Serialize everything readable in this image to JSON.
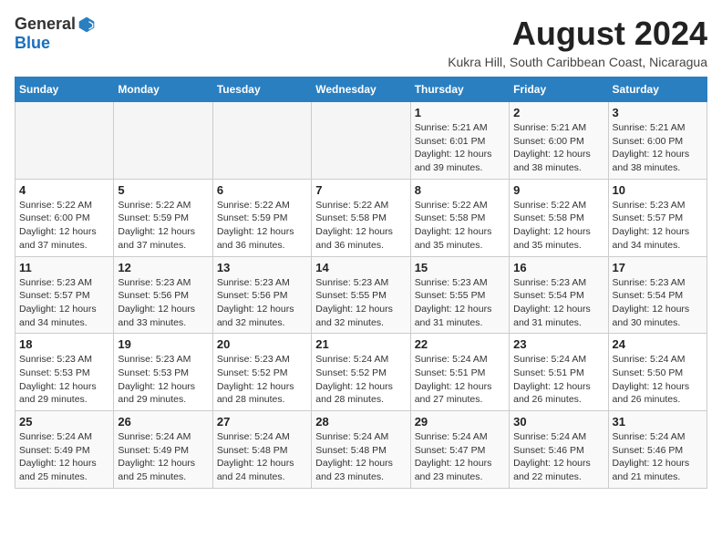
{
  "header": {
    "logo_general": "General",
    "logo_blue": "Blue",
    "month_year": "August 2024",
    "location": "Kukra Hill, South Caribbean Coast, Nicaragua"
  },
  "calendar": {
    "days_of_week": [
      "Sunday",
      "Monday",
      "Tuesday",
      "Wednesday",
      "Thursday",
      "Friday",
      "Saturday"
    ],
    "weeks": [
      [
        {
          "day": "",
          "info": ""
        },
        {
          "day": "",
          "info": ""
        },
        {
          "day": "",
          "info": ""
        },
        {
          "day": "",
          "info": ""
        },
        {
          "day": "1",
          "info": "Sunrise: 5:21 AM\nSunset: 6:01 PM\nDaylight: 12 hours and 39 minutes."
        },
        {
          "day": "2",
          "info": "Sunrise: 5:21 AM\nSunset: 6:00 PM\nDaylight: 12 hours and 38 minutes."
        },
        {
          "day": "3",
          "info": "Sunrise: 5:21 AM\nSunset: 6:00 PM\nDaylight: 12 hours and 38 minutes."
        }
      ],
      [
        {
          "day": "4",
          "info": "Sunrise: 5:22 AM\nSunset: 6:00 PM\nDaylight: 12 hours and 37 minutes."
        },
        {
          "day": "5",
          "info": "Sunrise: 5:22 AM\nSunset: 5:59 PM\nDaylight: 12 hours and 37 minutes."
        },
        {
          "day": "6",
          "info": "Sunrise: 5:22 AM\nSunset: 5:59 PM\nDaylight: 12 hours and 36 minutes."
        },
        {
          "day": "7",
          "info": "Sunrise: 5:22 AM\nSunset: 5:58 PM\nDaylight: 12 hours and 36 minutes."
        },
        {
          "day": "8",
          "info": "Sunrise: 5:22 AM\nSunset: 5:58 PM\nDaylight: 12 hours and 35 minutes."
        },
        {
          "day": "9",
          "info": "Sunrise: 5:22 AM\nSunset: 5:58 PM\nDaylight: 12 hours and 35 minutes."
        },
        {
          "day": "10",
          "info": "Sunrise: 5:23 AM\nSunset: 5:57 PM\nDaylight: 12 hours and 34 minutes."
        }
      ],
      [
        {
          "day": "11",
          "info": "Sunrise: 5:23 AM\nSunset: 5:57 PM\nDaylight: 12 hours and 34 minutes."
        },
        {
          "day": "12",
          "info": "Sunrise: 5:23 AM\nSunset: 5:56 PM\nDaylight: 12 hours and 33 minutes."
        },
        {
          "day": "13",
          "info": "Sunrise: 5:23 AM\nSunset: 5:56 PM\nDaylight: 12 hours and 32 minutes."
        },
        {
          "day": "14",
          "info": "Sunrise: 5:23 AM\nSunset: 5:55 PM\nDaylight: 12 hours and 32 minutes."
        },
        {
          "day": "15",
          "info": "Sunrise: 5:23 AM\nSunset: 5:55 PM\nDaylight: 12 hours and 31 minutes."
        },
        {
          "day": "16",
          "info": "Sunrise: 5:23 AM\nSunset: 5:54 PM\nDaylight: 12 hours and 31 minutes."
        },
        {
          "day": "17",
          "info": "Sunrise: 5:23 AM\nSunset: 5:54 PM\nDaylight: 12 hours and 30 minutes."
        }
      ],
      [
        {
          "day": "18",
          "info": "Sunrise: 5:23 AM\nSunset: 5:53 PM\nDaylight: 12 hours and 29 minutes."
        },
        {
          "day": "19",
          "info": "Sunrise: 5:23 AM\nSunset: 5:53 PM\nDaylight: 12 hours and 29 minutes."
        },
        {
          "day": "20",
          "info": "Sunrise: 5:23 AM\nSunset: 5:52 PM\nDaylight: 12 hours and 28 minutes."
        },
        {
          "day": "21",
          "info": "Sunrise: 5:24 AM\nSunset: 5:52 PM\nDaylight: 12 hours and 28 minutes."
        },
        {
          "day": "22",
          "info": "Sunrise: 5:24 AM\nSunset: 5:51 PM\nDaylight: 12 hours and 27 minutes."
        },
        {
          "day": "23",
          "info": "Sunrise: 5:24 AM\nSunset: 5:51 PM\nDaylight: 12 hours and 26 minutes."
        },
        {
          "day": "24",
          "info": "Sunrise: 5:24 AM\nSunset: 5:50 PM\nDaylight: 12 hours and 26 minutes."
        }
      ],
      [
        {
          "day": "25",
          "info": "Sunrise: 5:24 AM\nSunset: 5:49 PM\nDaylight: 12 hours and 25 minutes."
        },
        {
          "day": "26",
          "info": "Sunrise: 5:24 AM\nSunset: 5:49 PM\nDaylight: 12 hours and 25 minutes."
        },
        {
          "day": "27",
          "info": "Sunrise: 5:24 AM\nSunset: 5:48 PM\nDaylight: 12 hours and 24 minutes."
        },
        {
          "day": "28",
          "info": "Sunrise: 5:24 AM\nSunset: 5:48 PM\nDaylight: 12 hours and 23 minutes."
        },
        {
          "day": "29",
          "info": "Sunrise: 5:24 AM\nSunset: 5:47 PM\nDaylight: 12 hours and 23 minutes."
        },
        {
          "day": "30",
          "info": "Sunrise: 5:24 AM\nSunset: 5:46 PM\nDaylight: 12 hours and 22 minutes."
        },
        {
          "day": "31",
          "info": "Sunrise: 5:24 AM\nSunset: 5:46 PM\nDaylight: 12 hours and 21 minutes."
        }
      ]
    ]
  }
}
